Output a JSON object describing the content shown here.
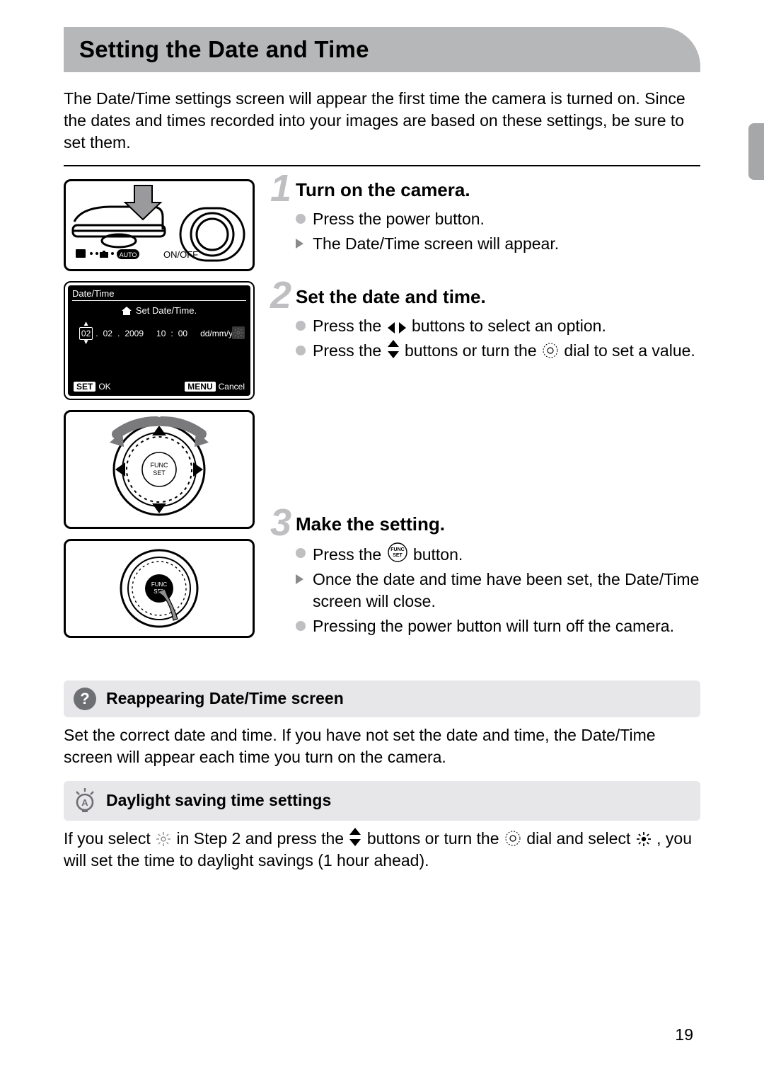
{
  "page_number": "19",
  "title": "Setting the Date and Time",
  "intro": "The Date/Time settings screen will appear the first time the camera is turned on. Since the dates and times recorded into your images are based on these settings, be sure to set them.",
  "power_label": "ON/OFF",
  "auto_label": "AUTO",
  "datetime_screen": {
    "title": "Date/Time",
    "set_label": "Set Date/Time.",
    "day": "02",
    "month": "02",
    "year": "2009",
    "hour": "10",
    "minute": "00",
    "format": "dd/mm/yy",
    "ok_chip": "SET",
    "ok_label": "OK",
    "cancel_chip": "MENU",
    "cancel_label": "Cancel"
  },
  "func_small": "FUNC\nSET",
  "steps": {
    "s1": {
      "num": "1",
      "title": "Turn on the camera.",
      "b1": "Press the power button.",
      "t1": "The Date/Time screen will appear."
    },
    "s2": {
      "num": "2",
      "title": "Set the date and time.",
      "b1_pre": "Press the ",
      "b1_post": " buttons to select an option.",
      "b2_pre": "Press the ",
      "b2_mid": " buttons or turn the ",
      "b2_post": " dial to set a value."
    },
    "s3": {
      "num": "3",
      "title": "Make the setting.",
      "b1_pre": "Press the ",
      "b1_post": " button.",
      "t1": "Once the date and time have been set, the Date/Time screen will close.",
      "b2": "Pressing the power button will turn off the camera."
    }
  },
  "info": {
    "q_title": "Reappearing Date/Time screen",
    "q_text": "Set the correct date and time. If you have not set the date and time, the Date/Time screen will appear each time you turn on the camera.",
    "tip_title": "Daylight saving time settings",
    "tip_pre": "If you select ",
    "tip_mid1": " in Step 2 and press the ",
    "tip_mid2": " buttons or turn the ",
    "tip_mid3": " dial and select ",
    "tip_post": ", you will set the time to daylight savings (1 hour ahead)."
  }
}
